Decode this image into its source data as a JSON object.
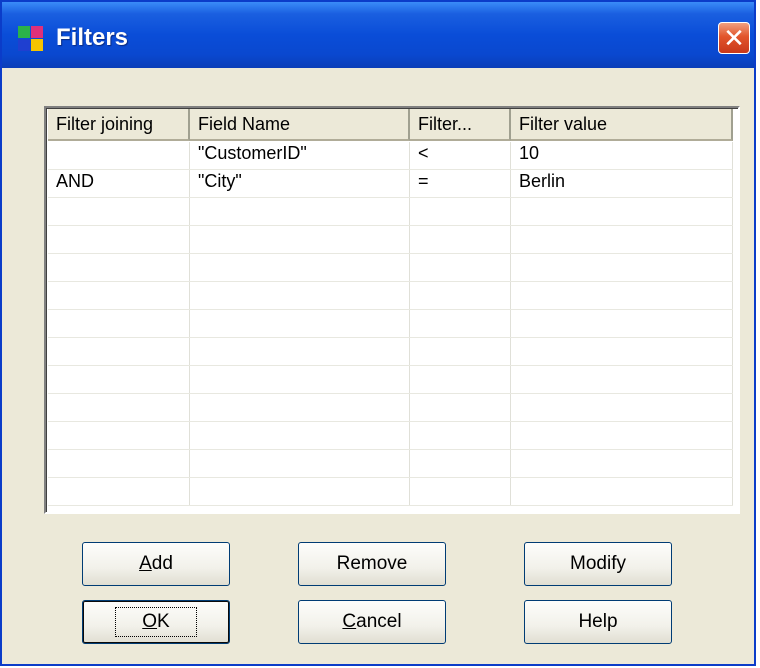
{
  "window": {
    "title": "Filters",
    "close_glyph": "✕"
  },
  "grid": {
    "columns": [
      "Filter joining",
      "Field Name",
      "Filter...",
      "Filter value"
    ],
    "rows": [
      [
        "",
        "\"CustomerID\"",
        "<",
        "10"
      ],
      [
        "AND",
        "\"City\"",
        "=",
        "Berlin"
      ],
      [
        "",
        "",
        "",
        ""
      ],
      [
        "",
        "",
        "",
        ""
      ],
      [
        "",
        "",
        "",
        ""
      ],
      [
        "",
        "",
        "",
        ""
      ],
      [
        "",
        "",
        "",
        ""
      ],
      [
        "",
        "",
        "",
        ""
      ],
      [
        "",
        "",
        "",
        ""
      ],
      [
        "",
        "",
        "",
        ""
      ],
      [
        "",
        "",
        "",
        ""
      ],
      [
        "",
        "",
        "",
        ""
      ],
      [
        "",
        "",
        "",
        ""
      ]
    ]
  },
  "buttons": {
    "add": {
      "underline": "A",
      "rest": "dd"
    },
    "remove": "Remove",
    "modify": "Modify",
    "ok": {
      "underline": "O",
      "rest": "K"
    },
    "cancel": {
      "underline": "C",
      "rest": "ancel"
    },
    "help": "Help"
  },
  "colors": {
    "titlebar": "#0a4dd8",
    "dialog_bg": "#ece9d8",
    "close_button": "#e2552b"
  }
}
